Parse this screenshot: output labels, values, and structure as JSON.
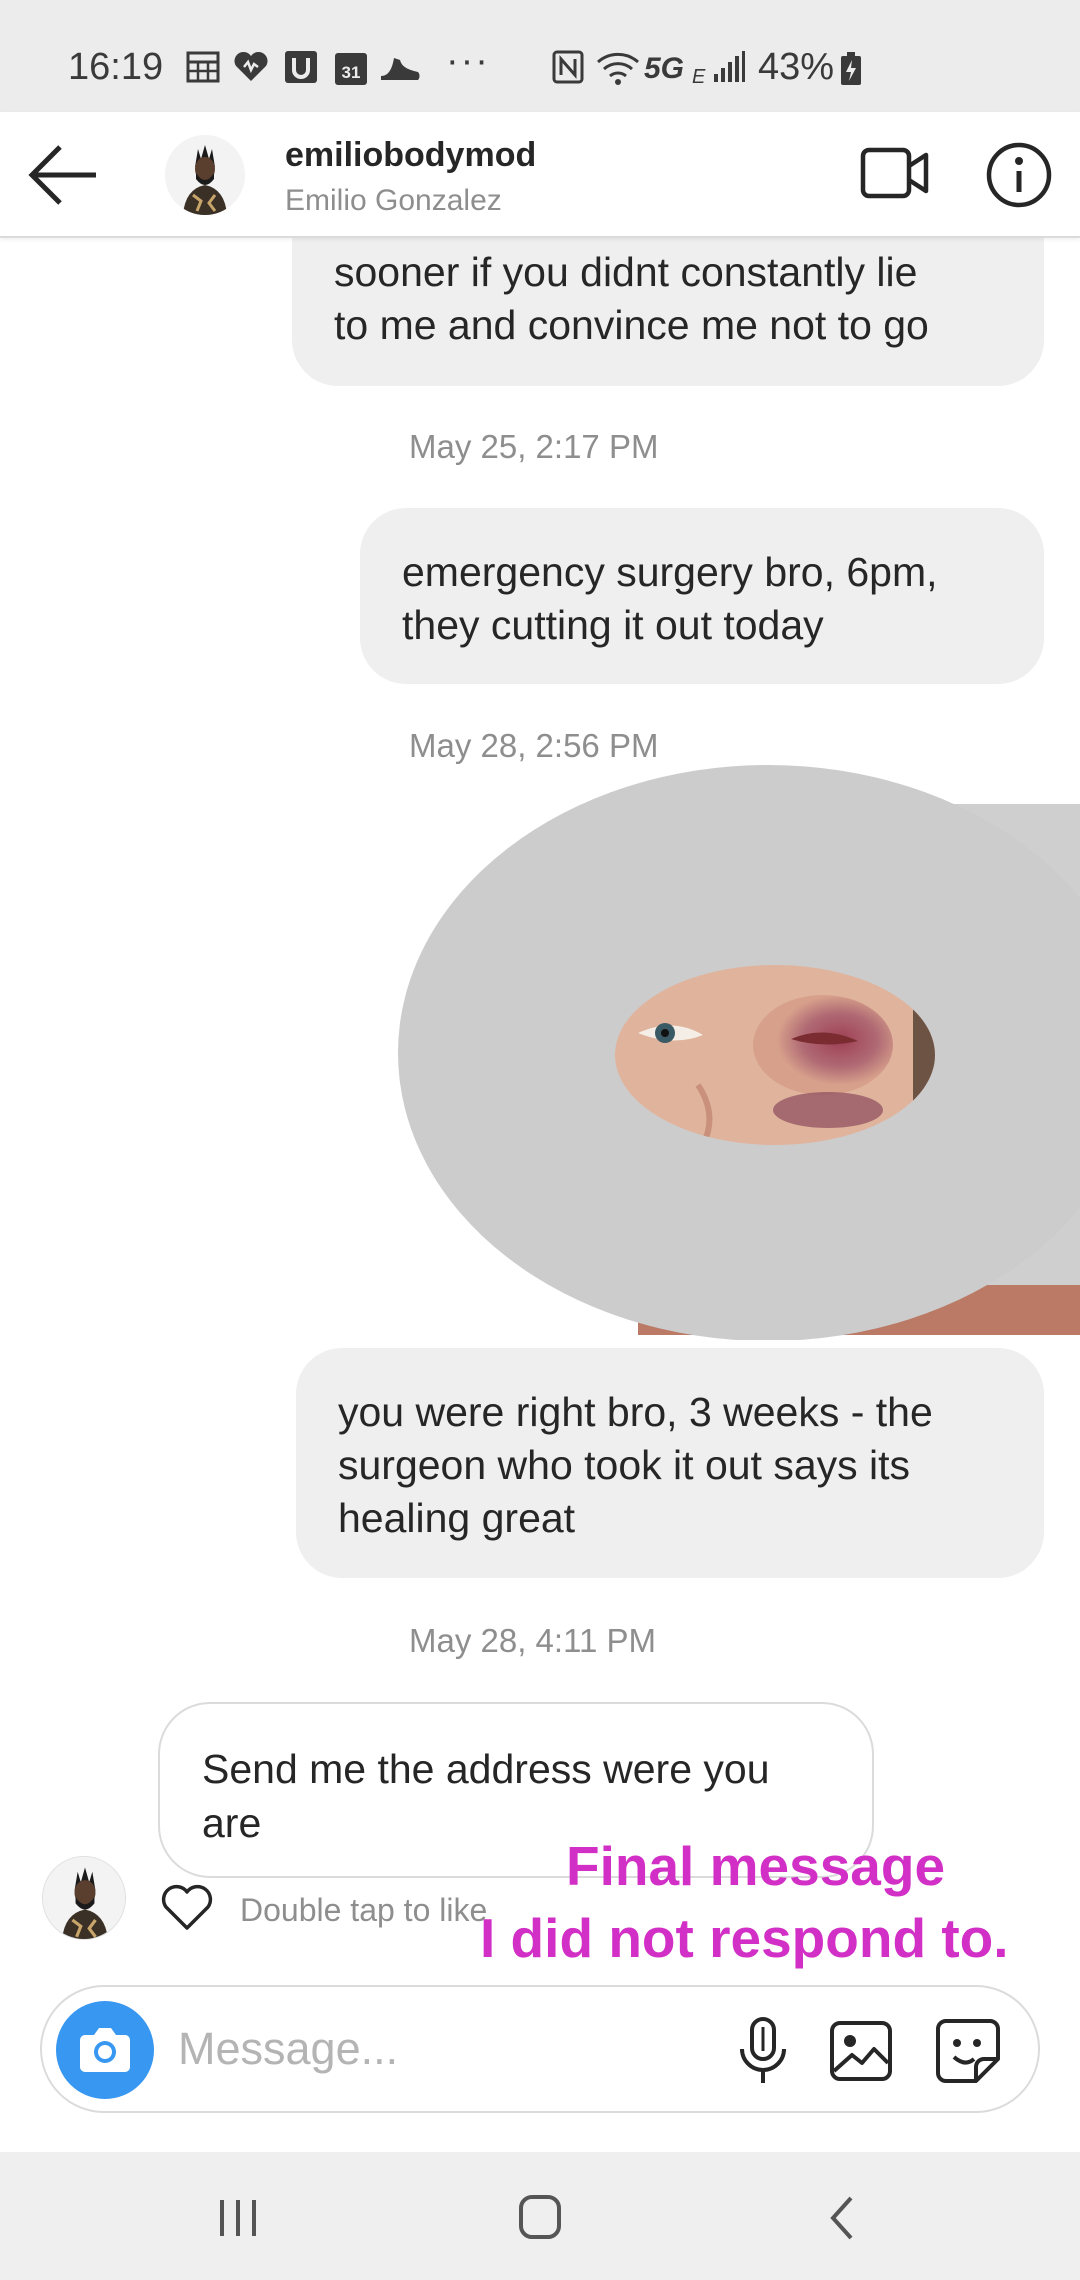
{
  "status_bar": {
    "time": "16:19",
    "more": "···",
    "network": "5G",
    "network_sub": "E",
    "battery": "43%"
  },
  "header": {
    "username": "emiliobodymod",
    "full_name": "Emilio Gonzalez"
  },
  "messages": [
    {
      "type": "outgoing",
      "lines": [
        "sooner if you didnt constantly lie",
        "to me and convince me not to go"
      ]
    },
    {
      "type": "timestamp",
      "text": "May 25, 2:17 PM"
    },
    {
      "type": "outgoing",
      "lines": [
        "emergency surgery bro, 6pm,",
        "they cutting it out today"
      ]
    },
    {
      "type": "timestamp",
      "text": "May 28, 2:56 PM"
    },
    {
      "type": "photo",
      "description": "close-up photo of a bruised swollen eye"
    },
    {
      "type": "outgoing",
      "lines": [
        "you were right bro, 3 weeks - the",
        "surgeon who took it out says its",
        "healing great"
      ]
    },
    {
      "type": "timestamp",
      "text": "May 28, 4:11 PM"
    },
    {
      "type": "incoming",
      "lines": [
        "Send me the address were you",
        "are"
      ]
    }
  ],
  "double_tap_hint": "Double tap to like",
  "annotation": [
    "Final message",
    "I did not respond to."
  ],
  "composer": {
    "placeholder": "Message..."
  },
  "colors": {
    "accent": "#3897f0",
    "annotation": "#d12fc5",
    "outgoing_bubble": "#efefef",
    "secondary_text": "#8e8e8e"
  },
  "icons": {
    "back": "arrow-left-icon",
    "video": "video-camera-icon",
    "info": "info-icon",
    "heart": "heart-icon",
    "camera": "camera-icon",
    "mic": "microphone-icon",
    "gallery": "image-icon",
    "sticker": "sticker-icon",
    "nav_recents": "recents-icon",
    "nav_home": "home-icon",
    "nav_back": "chevron-left-icon"
  }
}
